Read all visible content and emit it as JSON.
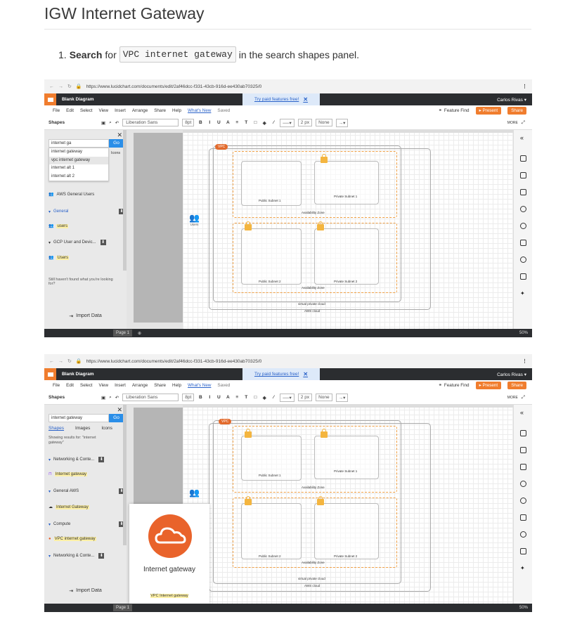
{
  "page": {
    "title": "IGW Internet Gateway",
    "step_number": "1.",
    "step_bold": "Search",
    "step_for": "for",
    "step_code": "VPC internet gateway",
    "step_rest": "in the search shapes panel."
  },
  "app": {
    "url": "https://www.lucidchart.com/documents/edit/2af46dcc-f331-43cb-916d-ee430ab70325/0",
    "doc_title": "Blank Diagram",
    "promo": "Try paid features free!",
    "promo_close": "✕",
    "user": "Carlos Rivas ▾",
    "menu": [
      "File",
      "Edit",
      "Select",
      "View",
      "Insert",
      "Arrange",
      "Share",
      "Help"
    ],
    "whats_new": "What's New",
    "saved": "Saved",
    "feature_find": "Feature Find",
    "present": "▸ Present",
    "share": "Share",
    "shapes": "Shapes",
    "font": "Liberation Sans",
    "font_size": "8pt",
    "line_width": "2 px",
    "none": "None",
    "more": "MORE",
    "import_data": "Import Data",
    "page_tab": "Page 1",
    "zoom": "50%"
  },
  "shot1": {
    "search_value": "internet ga",
    "go": "Go",
    "icons_tab": "Icons",
    "suggestions": [
      "internet gateway",
      "vpc internet gateway",
      "internet alt 1",
      "internet alt 2"
    ],
    "results": [
      {
        "label": "AWS General Users",
        "icon": "users-icon"
      },
      {
        "label": "General",
        "icon": "caret-icon"
      },
      {
        "label": "users",
        "icon": "users-icon"
      },
      {
        "label": "GCP User and Devic...",
        "icon": "caret-icon"
      },
      {
        "label": "Users",
        "icon": "users-icon"
      }
    ],
    "not_found": "Still haven't found what you're looking for?"
  },
  "shot2": {
    "search_value": "internet gateway",
    "tabs": [
      "Shapes",
      "Images",
      "Icons"
    ],
    "showing": "Showing results for: \"internet gateway\"",
    "results": [
      {
        "label": "Networking & Conte...",
        "icon": "caret-icon"
      },
      {
        "label": "Internet gateway",
        "icon": "internet-gateway-icon"
      },
      {
        "label": "General AWS",
        "icon": "caret-icon"
      },
      {
        "label": "Internet Gateway",
        "icon": "cloud-icon"
      },
      {
        "label": "Compute",
        "icon": "caret-icon"
      },
      {
        "label": "VPC internet gateway",
        "icon": "vpc-gateway-icon"
      },
      {
        "label": "Networking & Conte...",
        "icon": "caret-icon"
      }
    ],
    "preview_name": "Internet gateway",
    "preview_footer": "VPC Internet gateway"
  },
  "diagram": {
    "vpc": "VPC",
    "public_subnet_1": "Public Subnet 1",
    "private_subnet_1": "Private Subnet 1",
    "public_subnet_2": "Public Subnet 2",
    "private_subnet_2": "Private Subnet 2",
    "availability_zone": "Availability Zone",
    "virtual_private_cloud": "virtual private cloud",
    "aws_cloud": "AWS cloud",
    "users": "Users"
  },
  "colors": {
    "accent": "#f07d2e",
    "appbar": "#2b2d30",
    "link": "#2a62c9",
    "zone": "#f0a045",
    "lock": "#f4b53f",
    "gateway": "#e9632b"
  }
}
